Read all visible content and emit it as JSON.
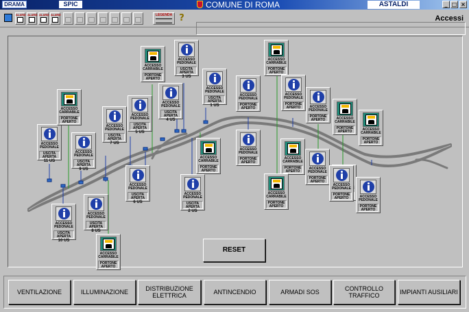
{
  "titlebar": {
    "logo_text": "DRAMA",
    "module": "SPIC",
    "title": "COMUNE DI ROMA",
    "company": "ASTALDI",
    "buttons": [
      "_",
      "□",
      "×"
    ]
  },
  "toolbar": {
    "button_caption": "ALARM",
    "legend_label": "LEGENDA",
    "help_glyph": "?"
  },
  "page": {
    "title": "Accessi"
  },
  "panels": [
    {
      "kind": "ped",
      "l1": "ACCESSO",
      "l2": "PEDONALE",
      "s1": "USCITA",
      "s2": "APERTA",
      "code": "11 US"
    },
    {
      "kind": "car",
      "l1": "ACCESSO",
      "l2": "CARRABILE",
      "s1": "PORTONE",
      "s2": "APERTO",
      "code": ""
    },
    {
      "kind": "ped",
      "l1": "ACCESSO",
      "l2": "PEDONALE",
      "s1": "USCITA",
      "s2": "APERTA",
      "code": "9 US"
    },
    {
      "kind": "ped",
      "l1": "ACCESSO",
      "l2": "PEDONALE",
      "s1": "USCITA",
      "s2": "APERTA",
      "code": "10 US"
    },
    {
      "kind": "ped",
      "l1": "ACCESSO",
      "l2": "PEDONALE",
      "s1": "USCITA",
      "s2": "APERTA",
      "code": "7 US"
    },
    {
      "kind": "ped",
      "l1": "ACCESSO",
      "l2": "PEDONALE",
      "s1": "USCITA",
      "s2": "APERTA",
      "code": "8 US"
    },
    {
      "kind": "car",
      "l1": "ACCESSO",
      "l2": "CARRABILE",
      "s1": "PORTONE",
      "s2": "APERTO",
      "code": ""
    },
    {
      "kind": "ped",
      "l1": "ACCESSO",
      "l2": "PEDONALE",
      "s1": "USCITA",
      "s2": "APERTA",
      "code": "5 US"
    },
    {
      "kind": "ped",
      "l1": "ACCESSO",
      "l2": "PEDONALE",
      "s1": "USCITA",
      "s2": "APERTA",
      "code": "6 US"
    },
    {
      "kind": "car",
      "l1": "ACCESSO",
      "l2": "CARRABILE",
      "s1": "PORTONE",
      "s2": "APERTO",
      "code": ""
    },
    {
      "kind": "ped",
      "l1": "ACCESSO",
      "l2": "PEDONALE",
      "s1": "USCITA",
      "s2": "APERTA",
      "code": "4 US"
    },
    {
      "kind": "ped",
      "l1": "ACCESSO",
      "l2": "PEDONALE",
      "s1": "USCITA",
      "s2": "APERTA",
      "code": "3 US"
    },
    {
      "kind": "ped",
      "l1": "ACCESSO",
      "l2": "PEDONALE",
      "s1": "USCITA",
      "s2": "APERTA",
      "code": "2 US"
    },
    {
      "kind": "ped",
      "l1": "ACCESSO",
      "l2": "PEDONALE",
      "s1": "USCITA",
      "s2": "APERTA",
      "code": "1 US"
    },
    {
      "kind": "car",
      "l1": "ACCESSO",
      "l2": "CARRABILE",
      "s1": "PORTONE",
      "s2": "APERTO",
      "code": ""
    },
    {
      "kind": "ped",
      "l1": "ACCESSO",
      "l2": "PEDONALE",
      "s1": "PORTONE",
      "s2": "APERTO",
      "code": ""
    },
    {
      "kind": "ped",
      "l1": "ACCESSO",
      "l2": "PEDONALE",
      "s1": "PORTONE",
      "s2": "APERTO",
      "code": ""
    },
    {
      "kind": "car",
      "l1": "ACCESSO",
      "l2": "CARRABILE",
      "s1": "PORTONE",
      "s2": "APERTO",
      "code": ""
    },
    {
      "kind": "ped",
      "l1": "ACCESSO",
      "l2": "PEDONALE",
      "s1": "PORTONE",
      "s2": "APERTO",
      "code": ""
    },
    {
      "kind": "car",
      "l1": "ACCESSO",
      "l2": "CARRABILE",
      "s1": "PORTONE",
      "s2": "APERTO",
      "code": ""
    },
    {
      "kind": "ped",
      "l1": "ACCESSO",
      "l2": "PEDONALE",
      "s1": "PORTONE",
      "s2": "APERTO",
      "code": ""
    },
    {
      "kind": "ped",
      "l1": "ACCESSO",
      "l2": "PEDONALE",
      "s1": "PORTONE",
      "s2": "APERTO",
      "code": ""
    },
    {
      "kind": "car",
      "l1": "ACCESSO",
      "l2": "CARRABILE",
      "s1": "PORTONE",
      "s2": "APERTO",
      "code": ""
    },
    {
      "kind": "car",
      "l1": "ACCESSO",
      "l2": "CARRABILE",
      "s1": "PORTONE",
      "s2": "APERTO",
      "code": ""
    },
    {
      "kind": "car",
      "l1": "ACCESSO",
      "l2": "CARRABILE",
      "s1": "PORTONE",
      "s2": "APERTO",
      "code": ""
    },
    {
      "kind": "car",
      "l1": "ACCESSO",
      "l2": "CARRABILE",
      "s1": "PORTONE",
      "s2": "APERTO",
      "code": ""
    },
    {
      "kind": "ped",
      "l1": "ACCESSO",
      "l2": "PEDONALE",
      "s1": "PORTONE",
      "s2": "APERTO",
      "code": ""
    },
    {
      "kind": "ped",
      "l1": "ACCESSO",
      "l2": "PEDONALE",
      "s1": "PORTONE",
      "s2": "APERTO",
      "code": ""
    }
  ],
  "reset_label": "RESET",
  "bottom_buttons": [
    "VENTILAZIONE",
    "ILLUMINAZIONE",
    "DISTRIBUZIONE ELETTRICA",
    "ANTINCENDIO",
    "ARMADI SOS",
    "CONTROLLO TRAFFICO",
    "IMPIANTI AUSILIARI"
  ],
  "colors": {
    "titlebar": "#0a246a",
    "window_bg": "#c0c0c0",
    "tunnel": "#7a7a7a",
    "link_ped": "#1f3fa8",
    "link_car": "#2a9a2a"
  }
}
